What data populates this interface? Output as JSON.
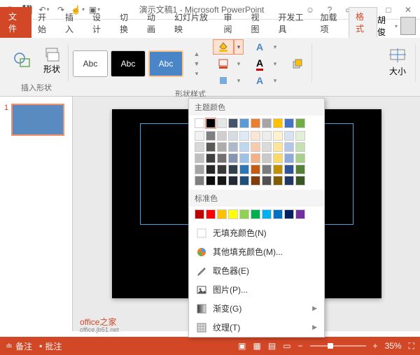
{
  "title": "演示文稿1 - Microsoft PowerPoint",
  "qat_icons": [
    "app",
    "save",
    "undo",
    "redo",
    "touch",
    "from-start"
  ],
  "tabs": {
    "file": "文件",
    "items": [
      "开始",
      "插入",
      "设计",
      "切换",
      "动画",
      "幻灯片放映",
      "审阅",
      "视图",
      "开发工具",
      "加载项"
    ],
    "active": "格式"
  },
  "user": {
    "name": "胡俊"
  },
  "ribbon": {
    "insert_shape": {
      "label": "插入形状",
      "btn": "形状"
    },
    "styles": {
      "label": "形状样式",
      "sample": "Abc"
    },
    "size": {
      "label": "大小"
    }
  },
  "thumbs": [
    {
      "num": "1"
    }
  ],
  "watermark": {
    "line1": "office之家",
    "line2": "office.jb51.net"
  },
  "color_menu": {
    "theme_label": "主题颜色",
    "theme_row1": [
      "#ffffff",
      "#000000",
      "#e7e6e6",
      "#44546a",
      "#5b9bd5",
      "#ed7d31",
      "#a5a5a5",
      "#ffc000",
      "#4472c4",
      "#70ad47"
    ],
    "theme_shades": [
      [
        "#f2f2f2",
        "#7f7f7f",
        "#d0cece",
        "#d6dce4",
        "#deebf6",
        "#fbe5d5",
        "#ededed",
        "#fff2cc",
        "#d9e2f3",
        "#e2efd9"
      ],
      [
        "#d8d8d8",
        "#595959",
        "#aeabab",
        "#adb9ca",
        "#bdd7ee",
        "#f7cbac",
        "#dbdbdb",
        "#fee599",
        "#b4c6e7",
        "#c5e0b3"
      ],
      [
        "#bfbfbf",
        "#3f3f3f",
        "#757070",
        "#8496b0",
        "#9cc3e5",
        "#f4b183",
        "#c9c9c9",
        "#ffd965",
        "#8eaadb",
        "#a8d08d"
      ],
      [
        "#a5a5a5",
        "#262626",
        "#3a3838",
        "#323f4f",
        "#2e75b5",
        "#c55a11",
        "#7b7b7b",
        "#bf9000",
        "#2f5496",
        "#538135"
      ],
      [
        "#7f7f7f",
        "#0c0c0c",
        "#171616",
        "#222a35",
        "#1e4e79",
        "#833c0b",
        "#525252",
        "#7f6000",
        "#1f3864",
        "#375623"
      ]
    ],
    "std_label": "标准色",
    "std": [
      "#c00000",
      "#ff0000",
      "#ffc000",
      "#ffff00",
      "#92d050",
      "#00b050",
      "#00b0f0",
      "#0070c0",
      "#002060",
      "#7030a0"
    ],
    "items": {
      "nofill": "无填充颜色(N)",
      "more": "其他填充颜色(M)...",
      "eyedrop": "取色器(E)",
      "picture": "图片(P)...",
      "gradient": "渐变(G)",
      "texture": "纹理(T)"
    }
  },
  "status": {
    "notes": "备注",
    "comments": "批注",
    "zoom": "35%"
  }
}
